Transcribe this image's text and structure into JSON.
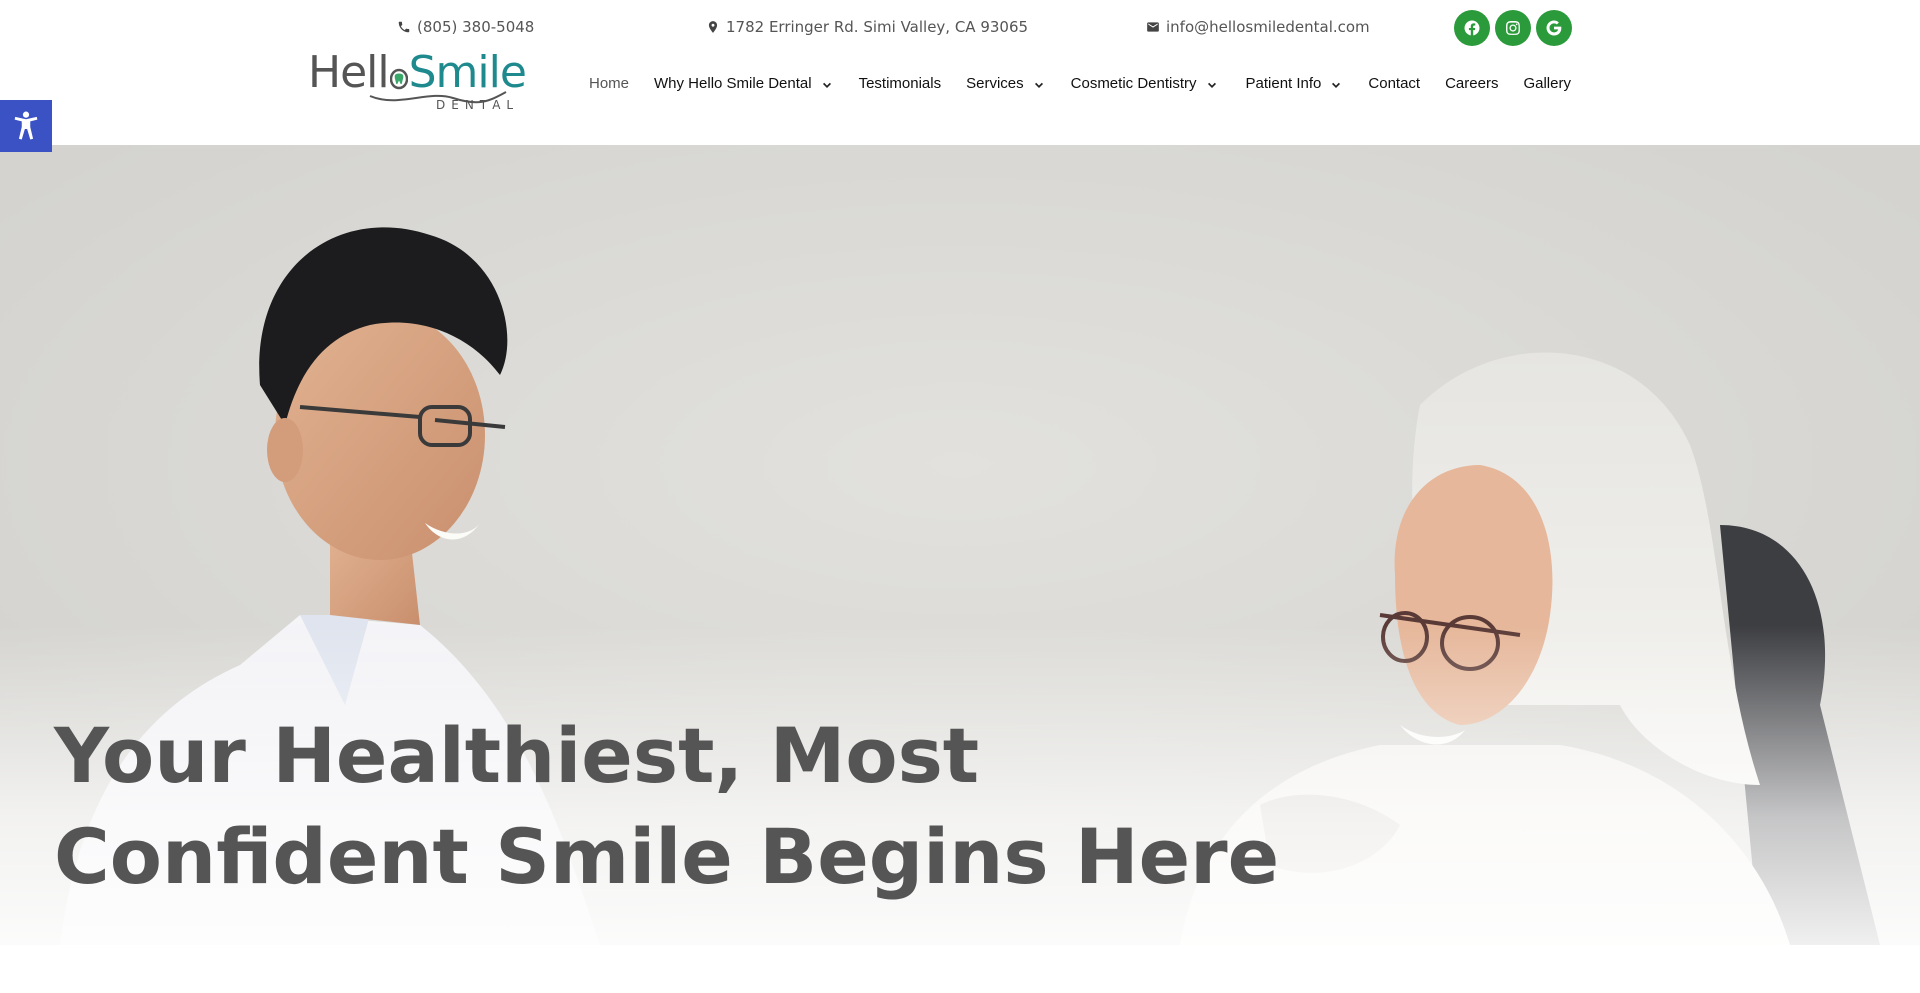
{
  "topbar": {
    "phone": "(805) 380-5048",
    "address": "1782 Erringer Rd. Simi Valley, CA 93065",
    "email": "info@hellosmiledental.com",
    "icons": {
      "phone": "phone-icon",
      "address": "map-marker-icon",
      "email": "envelope-icon"
    },
    "social": [
      {
        "name": "facebook-icon",
        "label": "Facebook"
      },
      {
        "name": "instagram-icon",
        "label": "Instagram"
      },
      {
        "name": "google-icon",
        "label": "Google"
      }
    ],
    "social_color": "#2a9a3a"
  },
  "logo": {
    "word_part1": "Hell",
    "word_part2": "Smile",
    "sub": "DENTAL",
    "colors": {
      "hello": "#555555",
      "smile": "#1f8a8e"
    }
  },
  "nav": {
    "items": [
      {
        "label": "Home",
        "dropdown": false,
        "active": true
      },
      {
        "label": "Why Hello Smile Dental",
        "dropdown": true
      },
      {
        "label": "Testimonials",
        "dropdown": false
      },
      {
        "label": "Services",
        "dropdown": true
      },
      {
        "label": "Cosmetic Dentistry",
        "dropdown": true
      },
      {
        "label": "Patient Info",
        "dropdown": true
      },
      {
        "label": "Contact",
        "dropdown": false
      },
      {
        "label": "Careers",
        "dropdown": false
      },
      {
        "label": "Gallery",
        "dropdown": false
      }
    ]
  },
  "accessibility": {
    "icon": "accessibility-icon",
    "color": "#3b52c4"
  },
  "hero": {
    "title_line1": "Your Healthiest, Most",
    "title_line2": "Confident Smile Begins Here"
  }
}
